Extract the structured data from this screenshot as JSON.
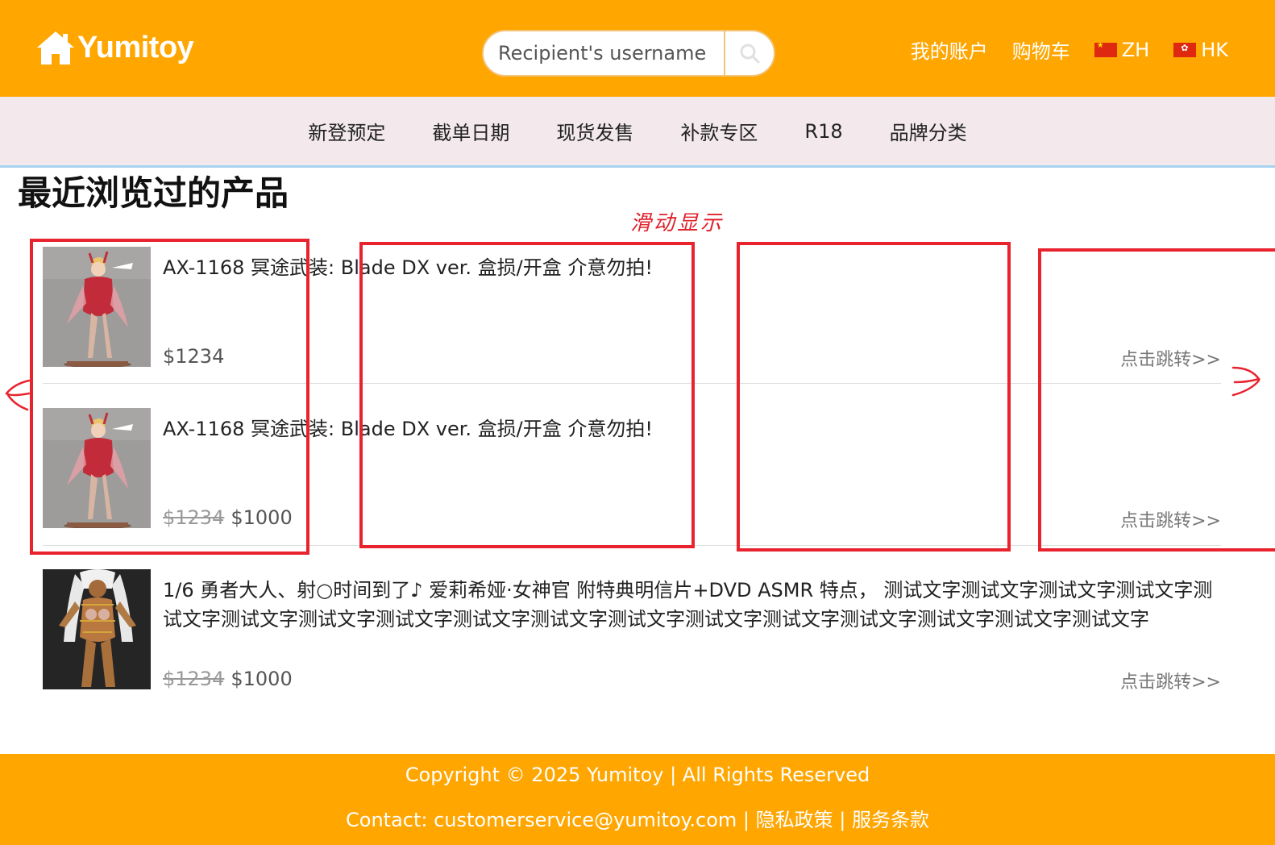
{
  "header": {
    "logo_text": "Yumitoy",
    "search_placeholder": "Recipient's username",
    "links": {
      "account": "我的账户",
      "cart": "购物车",
      "lang_zh": "ZH",
      "lang_hk": "HK"
    }
  },
  "nav": {
    "items": [
      "新登预定",
      "截单日期",
      "现货发售",
      "补款专区",
      "R18",
      "品牌分类"
    ]
  },
  "section": {
    "title": "最近浏览过的产品"
  },
  "products": [
    {
      "title": "AX-1168 冥途武装: Blade DX ver. 盒损/开盒 介意勿拍!",
      "old_price": "",
      "price": "$1234",
      "link": "点击跳转>>"
    },
    {
      "title": "AX-1168 冥途武装: Blade DX ver. 盒损/开盒 介意勿拍!",
      "old_price": "$1234",
      "price": "$1000",
      "link": "点击跳转>>"
    },
    {
      "title": "1/6 勇者大人、射○时间到了♪ 爱莉希娅·女神官 附特典明信片+DVD ASMR 特点， 测试文字测试文字测试文字测试文字测试文字测试文字测试文字测试文字测试文字测试文字测试文字测试文字测试文字测试文字测试文字测试文字测试文字",
      "old_price": "$1234",
      "price": "$1000",
      "link": "点击跳转>>"
    }
  ],
  "annotation": {
    "label": "滑动显示",
    "color": "#e8232e"
  },
  "footer": {
    "copyright": "Copyright © 2025 Yumitoy | All Rights Reserved",
    "contact": "Contact: customerservice@yumitoy.com | 隐私政策 | 服务条款"
  },
  "colors": {
    "brand": "#ffa600",
    "nav_bg": "#f3e9ec",
    "nav_border": "#a8d2ee"
  }
}
